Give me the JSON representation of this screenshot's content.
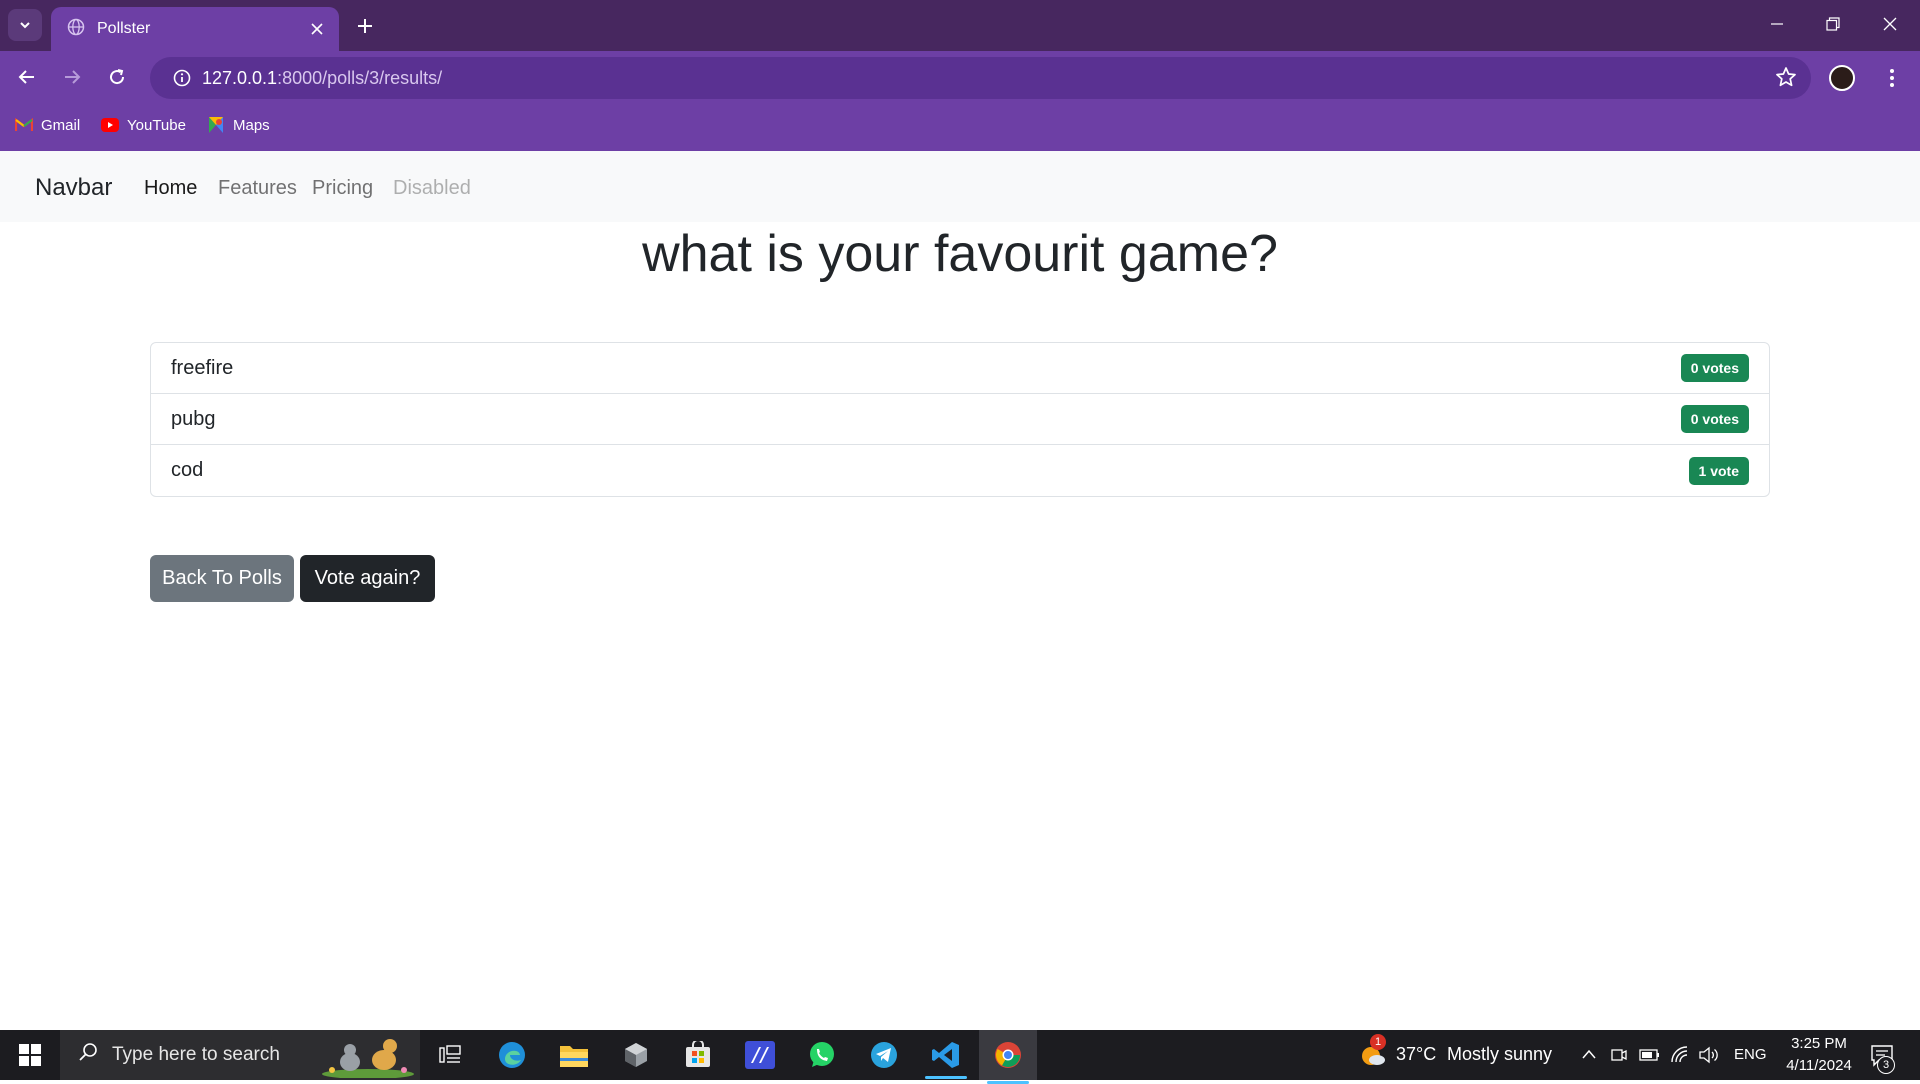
{
  "browser": {
    "tab_title": "Pollster",
    "url_host": "127.0.0.1",
    "url_rest": ":8000/polls/3/results/",
    "bookmarks": [
      {
        "label": "Gmail",
        "icon": "gmail-icon"
      },
      {
        "label": "YouTube",
        "icon": "youtube-icon"
      },
      {
        "label": "Maps",
        "icon": "maps-icon"
      }
    ]
  },
  "navbar": {
    "brand": "Navbar",
    "links": [
      {
        "label": "Home",
        "state": "active"
      },
      {
        "label": "Features",
        "state": "normal"
      },
      {
        "label": "Pricing",
        "state": "normal"
      },
      {
        "label": "Disabled",
        "state": "disabled"
      }
    ]
  },
  "poll": {
    "question": "what is your favourit game?",
    "choices": [
      {
        "text": "freefire",
        "votes": "0 votes"
      },
      {
        "text": "pubg",
        "votes": "0 votes"
      },
      {
        "text": "cod",
        "votes": "1 vote"
      }
    ],
    "back_button": "Back To Polls",
    "vote_again_button": "Vote again?"
  },
  "taskbar": {
    "search_placeholder": "Type here to search",
    "weather_badge": "1",
    "weather_temp": "37°C",
    "weather_text": "Mostly sunny",
    "language": "ENG",
    "time": "3:25 PM",
    "date": "4/11/2024",
    "notification_count": "3"
  },
  "colors": {
    "titlebar": "#47275f",
    "toolbar": "#6d3fa5",
    "vote_badge": "#198754",
    "secondary_button": "#6c757d",
    "dark_button": "#212529"
  }
}
